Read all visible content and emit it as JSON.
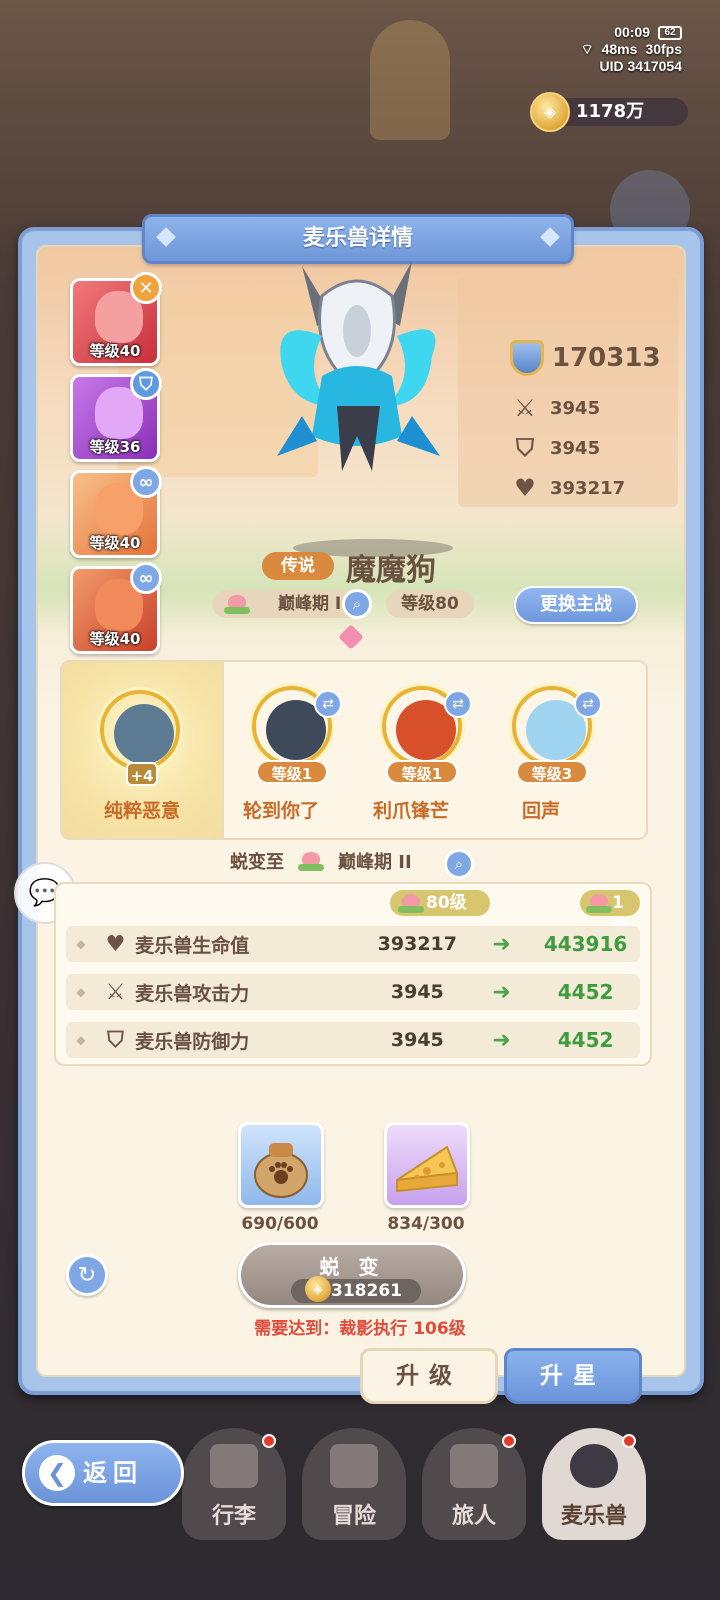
{
  "status": {
    "time": "00:09",
    "battery": "62",
    "ping": "48ms",
    "fps": "30fps",
    "uid": "UID 3417054"
  },
  "currency": {
    "amount": "1178万",
    "icon": "coin-icon"
  },
  "panel": {
    "title": "麦乐兽详情"
  },
  "side_pets": [
    {
      "level": "等级40",
      "badge_icon": "close-icon",
      "color": "#e04a4a"
    },
    {
      "level": "等级36",
      "badge_icon": "shield-icon",
      "color": "#a64ad6"
    },
    {
      "level": "等级40",
      "badge_icon": "link-icon",
      "color": "#e57a3a"
    },
    {
      "level": "等级40",
      "badge_icon": "link-icon",
      "color": "#d8582f"
    }
  ],
  "pet": {
    "rarity": "传说",
    "name": "魔魔狗",
    "stage": "巅峰期 I",
    "level": "等级80",
    "power": "170313",
    "attack": "3945",
    "defense": "3945",
    "hp": "393217"
  },
  "change_button": "更换主战",
  "skills": {
    "main": {
      "name": "纯粹恶意",
      "plus": "+4"
    },
    "others": [
      {
        "name": "轮到你了",
        "level": "等级1"
      },
      {
        "name": "利爪锋芒",
        "level": "等级1"
      },
      {
        "name": "回声",
        "level": "等级3"
      }
    ]
  },
  "evolve": {
    "to_label": "蜕变至",
    "to_stage": "巅峰期 II",
    "from_level": "80级",
    "to_level": "1级",
    "rows": [
      {
        "icon": "heart-icon",
        "label": "麦乐兽生命值",
        "old": "393217",
        "new": "443916"
      },
      {
        "icon": "sword-icon",
        "label": "麦乐兽攻击力",
        "old": "3945",
        "new": "4452"
      },
      {
        "icon": "shield-icon",
        "label": "麦乐兽防御力",
        "old": "3945",
        "new": "4452"
      }
    ],
    "materials": [
      {
        "icon": "food-bag-icon",
        "count": "690/600"
      },
      {
        "icon": "cheese-icon",
        "count": "834/300"
      }
    ],
    "button_label": "蜕 变",
    "cost": "318261",
    "requirement": "需要达到：裁影执行 106级"
  },
  "tabs": {
    "upgrade": "升级",
    "star": "升星"
  },
  "nav": {
    "back": "返回",
    "items": [
      "行李",
      "冒险",
      "旅人",
      "麦乐兽"
    ]
  },
  "colors": {
    "accent_blue": "#7fa7e6",
    "legend_orange": "#d98a3c",
    "gain_green": "#3e9c3e",
    "warn_red": "#e24a3a"
  }
}
